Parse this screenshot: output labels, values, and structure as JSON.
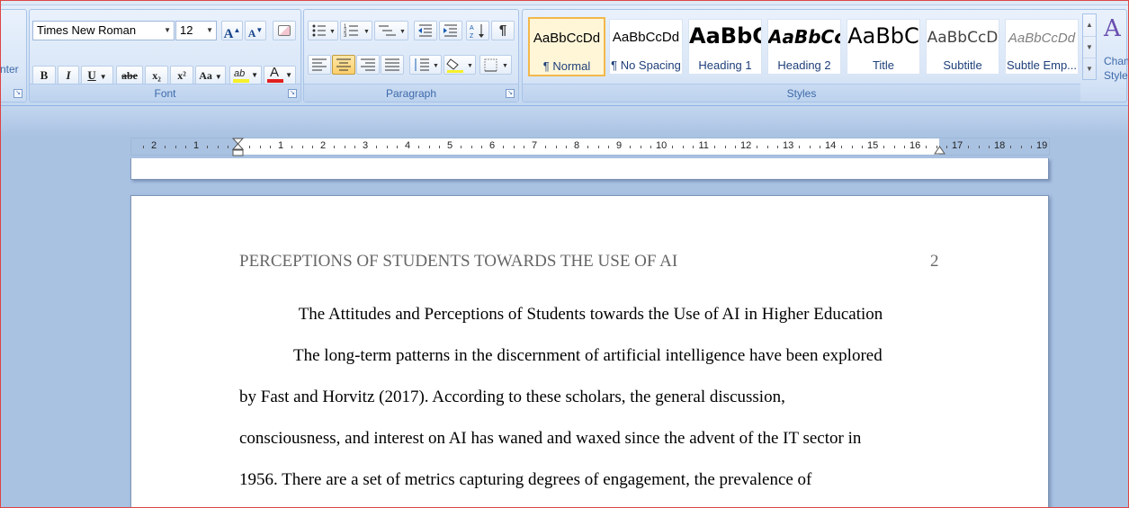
{
  "ribbon": {
    "clipboard": {
      "partial_label": "nter"
    },
    "font": {
      "group_label": "Font",
      "font_name": "Times New Roman",
      "font_size": "12",
      "grow_label": "A",
      "shrink_label": "A",
      "bold_label": "B",
      "italic_label": "I",
      "underline_label": "U",
      "strike_label": "abe",
      "subscript_label": "x₂",
      "superscript_label": "x²",
      "case_label": "Aa",
      "highlight_label": "ab",
      "font_color_label": "A",
      "highlight_color": "#f5ef2a",
      "font_color": "#e02020"
    },
    "paragraph": {
      "group_label": "Paragraph",
      "show_marks_label": "¶"
    },
    "styles": {
      "group_label": "Styles",
      "items": [
        {
          "preview": "AaBbCcDd",
          "name": "¶ Normal"
        },
        {
          "preview": "AaBbCcDd",
          "name": "¶ No Spacing"
        },
        {
          "preview": "AaBbC",
          "name": "Heading 1"
        },
        {
          "preview": "AaBbCc",
          "name": "Heading 2"
        },
        {
          "preview": "AaBbC",
          "name": "Title"
        },
        {
          "preview": "AaBbCcD",
          "name": "Subtitle"
        },
        {
          "preview": "AaBbCcDd",
          "name": "Subtle Emp..."
        }
      ],
      "change_styles_label_1": "Chan",
      "change_styles_label_2": "Style"
    }
  },
  "ruler": {
    "left_numbers": [
      "2",
      "1"
    ],
    "numbers": [
      "1",
      "2",
      "3",
      "4",
      "5",
      "6",
      "7",
      "8",
      "9",
      "10",
      "11",
      "12",
      "13",
      "14",
      "15",
      "16",
      "17",
      "18",
      "19"
    ]
  },
  "document": {
    "running_head": "PERCEPTIONS OF STUDENTS TOWARDS THE USE OF AI",
    "page_number": "2",
    "title": "The Attitudes and Perceptions of Students towards the Use of AI in Higher Education",
    "lines": [
      "The long-term patterns in the discernment of artificial intelligence have been explored",
      "by Fast and Horvitz (2017). According to these scholars, the general discussion,",
      "consciousness, and interest on AI has waned and waxed since the advent of the IT sector in",
      "1956. There are a set of metrics capturing degrees of engagement, the prevalence of"
    ]
  }
}
